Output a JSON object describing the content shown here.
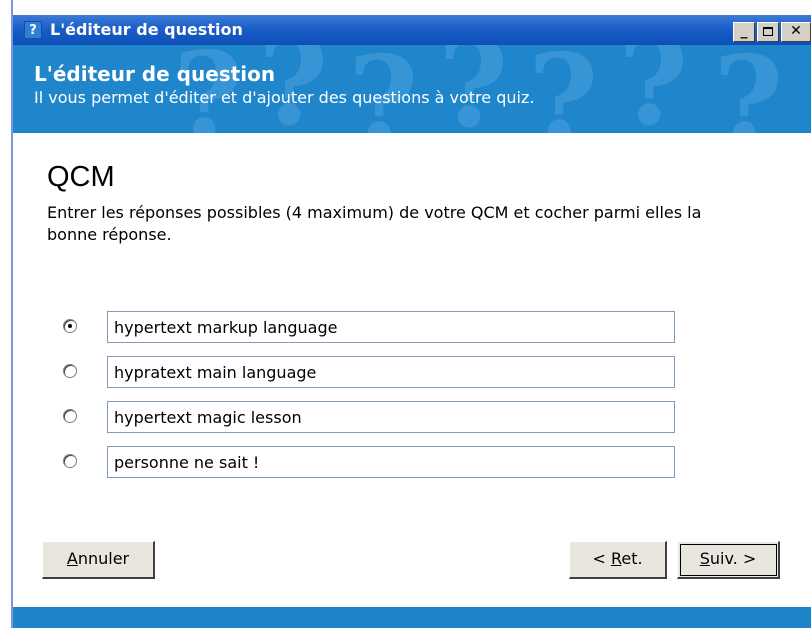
{
  "window": {
    "title": "L'éditeur de question",
    "icon": "question-mark-icon",
    "controls": [
      "minimize",
      "maximize",
      "close"
    ]
  },
  "header": {
    "title": "L'éditeur de question",
    "subtitle": "Il vous permet d'éditer et d'ajouter des questions à votre quiz."
  },
  "main": {
    "section_title": "QCM",
    "instruction": "Entrer les réponses possibles (4 maximum) de votre QCM et cocher parmi elles la bonne réponse.",
    "answers": [
      {
        "value": "hypertext markup language",
        "checked": true
      },
      {
        "value": "hypratext main language",
        "checked": false
      },
      {
        "value": "hypertext magic lesson",
        "checked": false
      },
      {
        "value": "personne ne sait !",
        "checked": false
      }
    ]
  },
  "buttons": {
    "cancel_access": "A",
    "cancel_rest": "nnuler",
    "back_prefix": "< ",
    "back_access": "R",
    "back_rest": "et.",
    "next_access": "S",
    "next_rest": "uiv. >"
  },
  "colors": {
    "titlebar": "#0f4fb8",
    "banner": "#1f86cc",
    "footer": "#1e84c8"
  }
}
